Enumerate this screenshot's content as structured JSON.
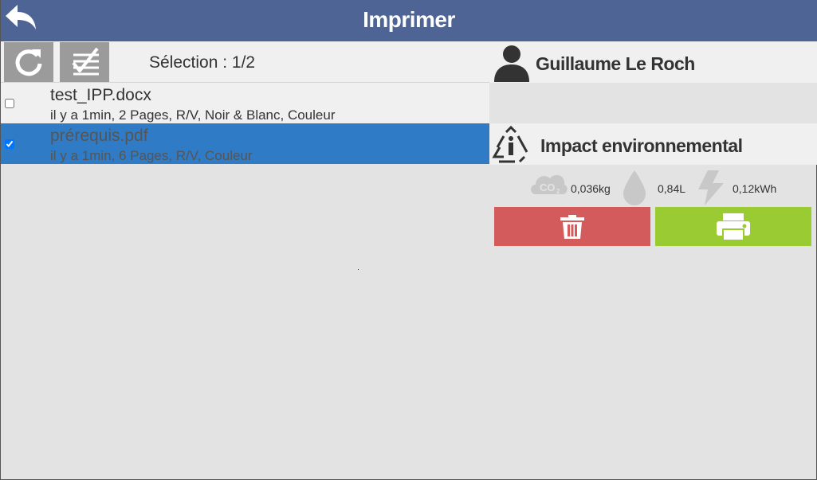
{
  "header": {
    "title": "Imprimer",
    "back_icon": "back-arrow-icon",
    "color": "#4e6494"
  },
  "toolbar": {
    "refresh_icon": "refresh-icon",
    "select_all_icon": "select-all-icon",
    "selection_label": "Sélection : 1/2"
  },
  "files": [
    {
      "name": "test_IPP.docx",
      "meta": "il y a 1min, 2 Pages, R/V, Noir & Blanc, Couleur",
      "checked": false
    },
    {
      "name": "prérequis.pdf",
      "meta": "il y a 1min, 6 Pages, R/V, Couleur",
      "checked": true
    }
  ],
  "user": {
    "icon": "user-icon",
    "name": "Guillaume Le Roch"
  },
  "impact": {
    "icon": "recycle-info-icon",
    "title": "Impact environnemental",
    "metrics": [
      {
        "icon": "co2-cloud-icon",
        "value": "0,036kg"
      },
      {
        "icon": "water-drop-icon",
        "value": "0,84L"
      },
      {
        "icon": "lightning-icon",
        "value": "0,12kWh"
      }
    ]
  },
  "actions": {
    "delete_icon": "trash-icon",
    "print_icon": "printer-icon",
    "delete_color": "#d35b5b",
    "print_color": "#9bcb33",
    "selected_row_color": "#2f7bc6"
  }
}
